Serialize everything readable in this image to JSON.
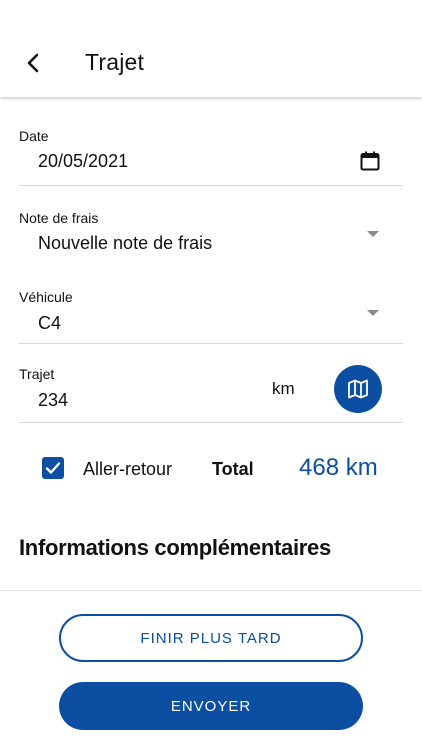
{
  "header": {
    "title": "Trajet",
    "back_icon": "chevron-left-icon"
  },
  "form": {
    "date": {
      "label": "Date",
      "value": "20/05/2021",
      "icon": "calendar-icon"
    },
    "expense_note": {
      "label": "Note de frais",
      "value": "Nouvelle note de frais"
    },
    "vehicle": {
      "label": "Véhicule",
      "value": "C4"
    },
    "trip": {
      "label": "Trajet",
      "value": "234",
      "unit": "km",
      "map_icon": "map-icon"
    },
    "round_trip": {
      "label": "Aller-retour",
      "checked": true
    },
    "total": {
      "label": "Total",
      "value": "468 km"
    }
  },
  "section": {
    "title": "Informations complémentaires"
  },
  "actions": {
    "finish_later": "FINIR PLUS TARD",
    "send": "ENVOYER"
  },
  "colors": {
    "primary": "#0b4ea2",
    "divider": "#d7d7d7",
    "text": "#111111"
  }
}
